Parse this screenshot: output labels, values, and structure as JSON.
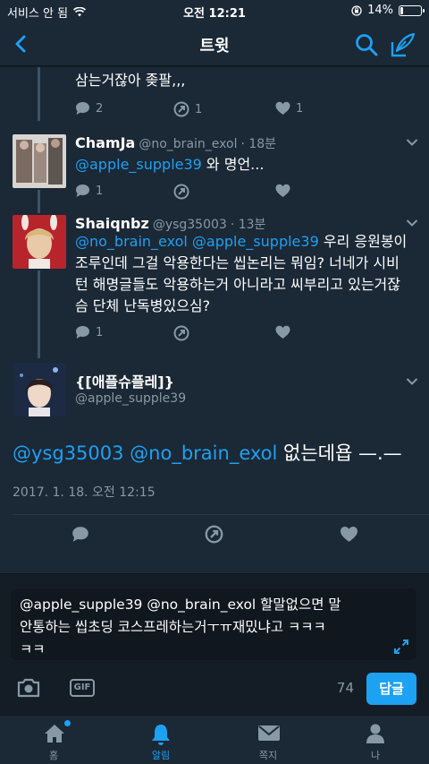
{
  "status": {
    "carrier": "서비스 안 됨",
    "time": "오전 12:21",
    "battery_text": "14%",
    "battery_level": 0.14
  },
  "nav": {
    "title": "트윗"
  },
  "thread": [
    {
      "text": "삼는거잖아 좆팔,,,",
      "reply_count": "2",
      "retweet_count": "1",
      "like_count": "1"
    },
    {
      "name": "ChamJa",
      "handle": "@no_brain_exol",
      "time": "· 18분",
      "text_mention": "@apple_supple39",
      "text_rest": " 와 명언...",
      "reply_count": "1",
      "retweet_count": "",
      "like_count": ""
    },
    {
      "name": "Shaiqnbz",
      "handle": "@ysg35003",
      "time": "· 13분",
      "line1_mentions": "@no_brain_exol @apple_supple39",
      "line1_rest": " 우리 응원봉이",
      "line2": "조루인데 그걸 악용한다는 씹논리는 뭐임? 너네가 시비",
      "line3": "턴 해명글들도 악용하는거 아니라고 씨부리고 있는거잖",
      "line4": "슴 단체 난독병있으심?",
      "reply_count": "1",
      "retweet_count": "",
      "like_count": ""
    }
  ],
  "main_tweet": {
    "name": "{[애플슈플레]}",
    "handle": "@apple_supple39",
    "mentions": "@ysg35003 @no_brain_exol",
    "text_rest": " 없는데욥 —.—",
    "date": "2017. 1. 18. 오전 12:15"
  },
  "compose": {
    "line1": "@apple_supple39 @no_brain_exol 할말없으면 말",
    "line2": "안통하는 씹초딩 코스프레하는거ㅜㅠ재밌냐고 ㅋㅋㅋ",
    "line3": "ㅋㅋ",
    "char_count": "74",
    "reply_label": "답글",
    "gif_label": "GIF"
  },
  "tabs": [
    {
      "label": "홈"
    },
    {
      "label": "알림"
    },
    {
      "label": "쪽지"
    },
    {
      "label": "나"
    }
  ],
  "colors": {
    "accent": "#1da1f2",
    "background": "#1b2836",
    "muted": "#8899a6"
  }
}
